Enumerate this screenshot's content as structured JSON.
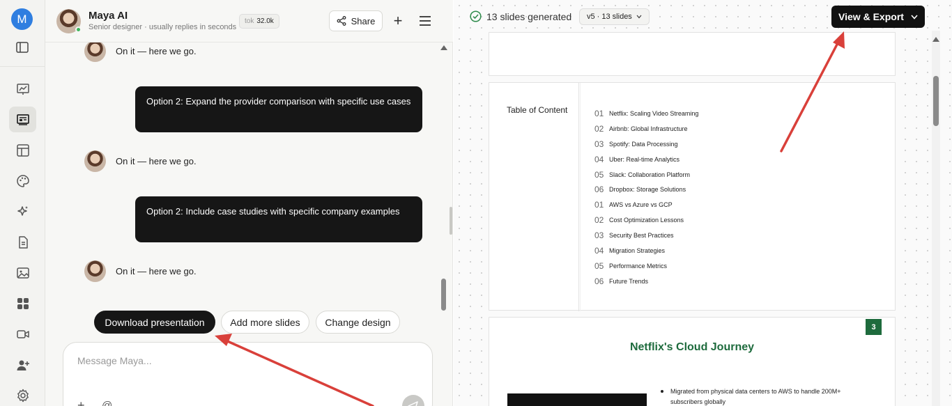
{
  "rail": {
    "user_initial": "M",
    "nav": [
      {
        "name": "analytics-icon"
      },
      {
        "name": "presentation-icon",
        "active": true
      },
      {
        "name": "layout-icon"
      },
      {
        "name": "palette-icon"
      },
      {
        "name": "sparkles-icon"
      },
      {
        "name": "document-icon"
      },
      {
        "name": "image-icon"
      },
      {
        "name": "apps-icon"
      },
      {
        "name": "video-icon"
      },
      {
        "name": "add-user-icon"
      },
      {
        "name": "settings-icon"
      }
    ]
  },
  "chat": {
    "agent_name": "Maya AI",
    "agent_status": "Senior designer · usually replies in seconds",
    "tok_label": "tok",
    "tok_value": "32.0k",
    "share_label": "Share",
    "plus_label": "+",
    "messages": [
      {
        "role": "agent",
        "text": "On it — here we go."
      },
      {
        "role": "user",
        "text": "Option 2: Expand the provider comparison with specific use cases"
      },
      {
        "role": "agent",
        "text": "On it — here we go."
      },
      {
        "role": "user",
        "text": "Option 2: Include case studies with specific company examples"
      },
      {
        "role": "agent",
        "text": "On it — here we go."
      }
    ],
    "quick_actions": [
      "Download presentation",
      "Add more slides",
      "Change design"
    ],
    "composer_placeholder": "Message Maya...",
    "composer_plus": "+",
    "composer_at": "@"
  },
  "preview": {
    "status_text": "13 slides generated",
    "version_label": "v5 · 13 slides",
    "export_label": "View & Export",
    "toc": {
      "title": "Table of Content",
      "items": [
        {
          "num": "01",
          "label": "Netflix: Scaling Video Streaming"
        },
        {
          "num": "02",
          "label": "Airbnb: Global Infrastructure"
        },
        {
          "num": "03",
          "label": "Spotify: Data Processing"
        },
        {
          "num": "04",
          "label": "Uber: Real-time Analytics"
        },
        {
          "num": "05",
          "label": "Slack: Collaboration Platform"
        },
        {
          "num": "06",
          "label": "Dropbox: Storage Solutions"
        },
        {
          "num": "01",
          "label": "AWS vs Azure vs GCP"
        },
        {
          "num": "02",
          "label": "Cost Optimization Lessons"
        },
        {
          "num": "03",
          "label": "Security Best Practices"
        },
        {
          "num": "04",
          "label": "Migration Strategies"
        },
        {
          "num": "05",
          "label": "Performance Metrics"
        },
        {
          "num": "06",
          "label": "Future Trends"
        }
      ]
    },
    "slide3": {
      "number": "3",
      "title": "Netflix's Cloud Journey",
      "bullet": "Migrated from physical data centers to AWS to handle 200M+ subscribers globally"
    },
    "accent_color": "#1e6b3d"
  },
  "colors": {
    "annotation_arrow": "#d9403a",
    "primary_dark": "#161616",
    "avatar_blue": "#2f7ee0"
  }
}
